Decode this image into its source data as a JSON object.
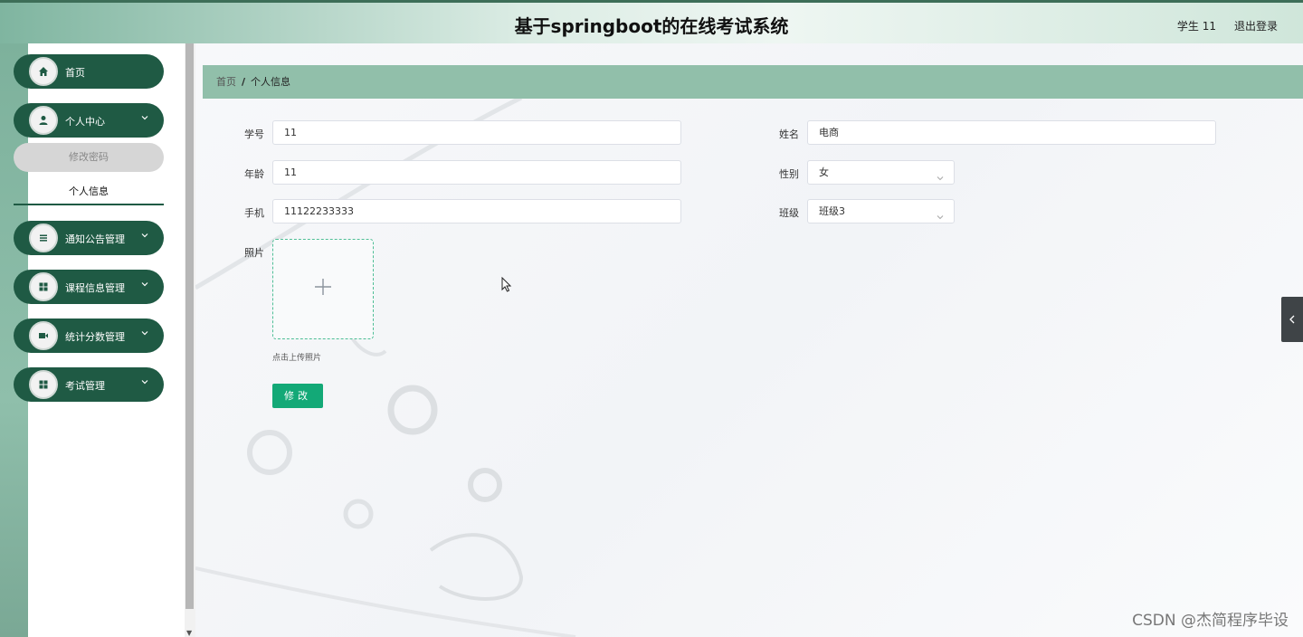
{
  "header": {
    "title": "基于springboot的在线考试系统",
    "user": "学生 11",
    "logout": "退出登录"
  },
  "sidebar": {
    "items": [
      {
        "label": "首页",
        "icon": "home-icon"
      },
      {
        "label": "个人中心",
        "icon": "user-icon"
      },
      {
        "label": "通知公告管理",
        "icon": "list-icon"
      },
      {
        "label": "课程信息管理",
        "icon": "grid-icon"
      },
      {
        "label": "统计分数管理",
        "icon": "video-icon"
      },
      {
        "label": "考试管理",
        "icon": "grid-icon"
      }
    ],
    "sub_items": [
      {
        "label": "修改密码"
      },
      {
        "label": "个人信息"
      }
    ]
  },
  "breadcrumb": {
    "home": "首页",
    "sep": "/",
    "current": "个人信息"
  },
  "form": {
    "student_id_label": "学号",
    "student_id": "11",
    "name_label": "姓名",
    "name": "电商",
    "age_label": "年龄",
    "age": "11",
    "gender_label": "性别",
    "gender": "女",
    "phone_label": "手机",
    "phone": "11122233333",
    "class_label": "班级",
    "class": "班级3",
    "photo_label": "照片",
    "upload_tip": "点击上传照片",
    "submit_label": "修改"
  },
  "watermark": "CSDN @杰简程序毕设",
  "colors": {
    "sidebar_green": "#1f5a44",
    "breadcrumb_bg": "#91bfaa",
    "button_green": "#13a977"
  }
}
